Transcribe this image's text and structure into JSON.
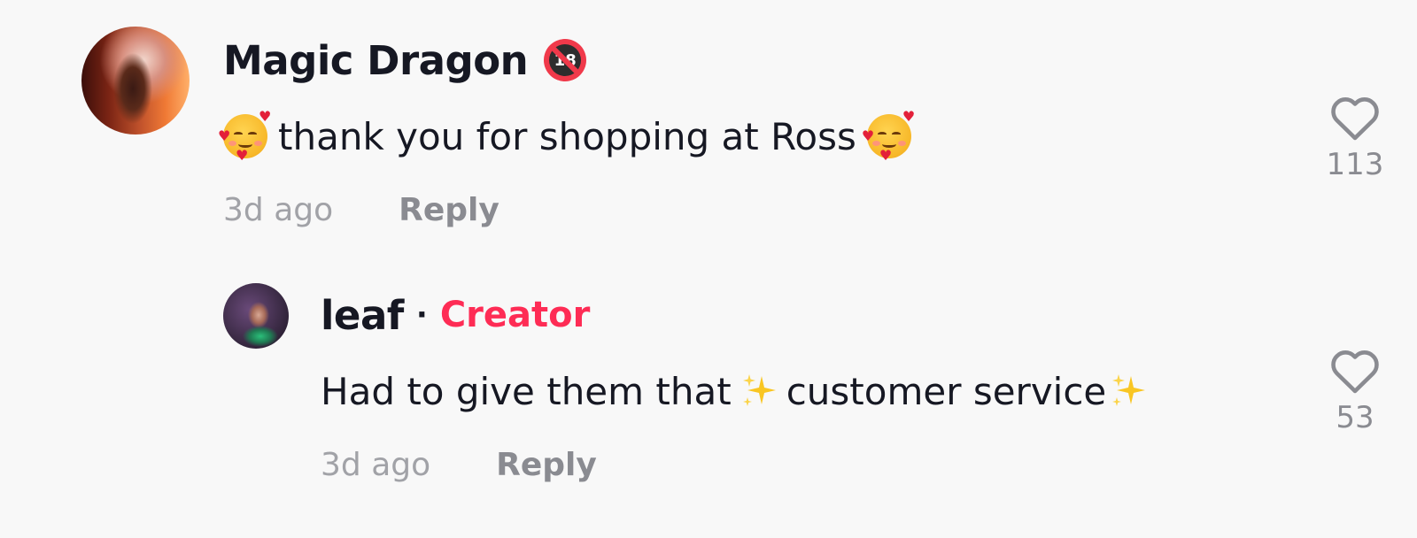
{
  "comment": {
    "username": "Magic Dragon",
    "badge_text": "18",
    "text": "thank you for shopping at Ross",
    "leading_emoji": "smiling-face-with-hearts",
    "trailing_emoji": "smiling-face-with-hearts",
    "time": "3d ago",
    "reply_label": "Reply",
    "likes": "113"
  },
  "reply": {
    "username": "leaf",
    "separator": "·",
    "creator_label": "Creator",
    "text_before": "Had to give them that",
    "text_middle": "customer service",
    "emoji": "sparkles",
    "time": "3d ago",
    "reply_label": "Reply",
    "likes": "53"
  },
  "colors": {
    "background": "#f8f8f8",
    "username": "#161823",
    "creator": "#fe2c55",
    "meta": "#a1a2a7",
    "icon": "#8a8b91"
  }
}
